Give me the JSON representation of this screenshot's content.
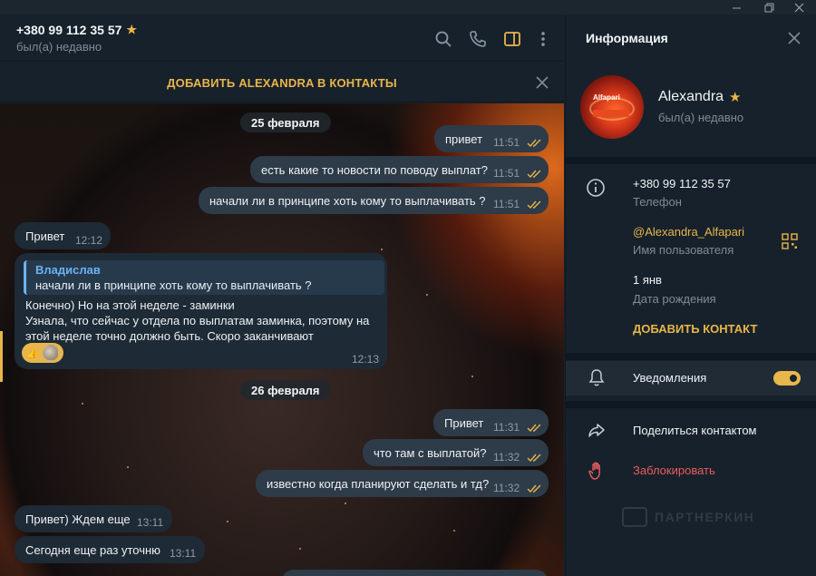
{
  "header": {
    "contact_name": "+380 99 112 35 57",
    "status": "был(а) недавно"
  },
  "add_bar": {
    "label": "ДОБАВИТЬ ALEXANDRA В КОНТАКТЫ"
  },
  "messages": {
    "date1": "25 февраля",
    "date2": "26 февраля",
    "m1": {
      "text": "привет",
      "time": "11:51"
    },
    "m2": {
      "text": "есть какие то новости по поводу выплат?",
      "time": "11:51"
    },
    "m3": {
      "text": "начали ли в принципе хоть кому то выплачивать ?",
      "time": "11:51"
    },
    "m4": {
      "text": "Привет",
      "time": "12:12"
    },
    "m5": {
      "reply_name": "Владислав",
      "reply_text": "начали ли в принципе хоть кому то выплачивать ?",
      "line1": "Конечно) Но на этой неделе - заминки",
      "line2": "Узнала, что сейчас у отдела по выплатам заминка, поэтому на",
      "line3": "этой неделе точно должно быть. Скоро заканчивают",
      "time": "12:13"
    },
    "m6": {
      "text": "Привет",
      "time": "11:31"
    },
    "m7": {
      "text": "что там с выплатой?",
      "time": "11:32"
    },
    "m8": {
      "text": "известно когда планируют сделать и тд?",
      "time": "11:32"
    },
    "m9": {
      "text": "Привет) Ждем еще",
      "time": "13:11"
    },
    "m10": {
      "text": "Сегодня еще раз уточню",
      "time": "13:11"
    }
  },
  "panel": {
    "title": "Информация",
    "name": "Alexandra",
    "status": "был(а) недавно",
    "avatar_text": "Alfapari",
    "phone": "+380 99 112 35 57",
    "phone_label": "Телефон",
    "username": "@Alexandra_Alfapari",
    "username_label": "Имя пользователя",
    "birthday": "1 янв",
    "birthday_label": "Дата рождения",
    "add_contact": "ДОБАВИТЬ КОНТАКТ",
    "notifications": "Уведомления",
    "notifications_on": true,
    "share": "Поделиться контактом",
    "block": "Заблокировать",
    "watermark": "ПАРТНЕРКИН"
  },
  "colors": {
    "accent": "#e8b64a",
    "danger": "#e85d5d",
    "link": "#6ab3f3"
  },
  "icons": [
    "star-icon",
    "search-icon",
    "phone-icon",
    "sidebar-toggle-icon",
    "more-icon",
    "close-icon",
    "info-icon",
    "qr-code-icon",
    "bell-icon",
    "share-icon",
    "hand-block-icon",
    "double-check-icon"
  ]
}
